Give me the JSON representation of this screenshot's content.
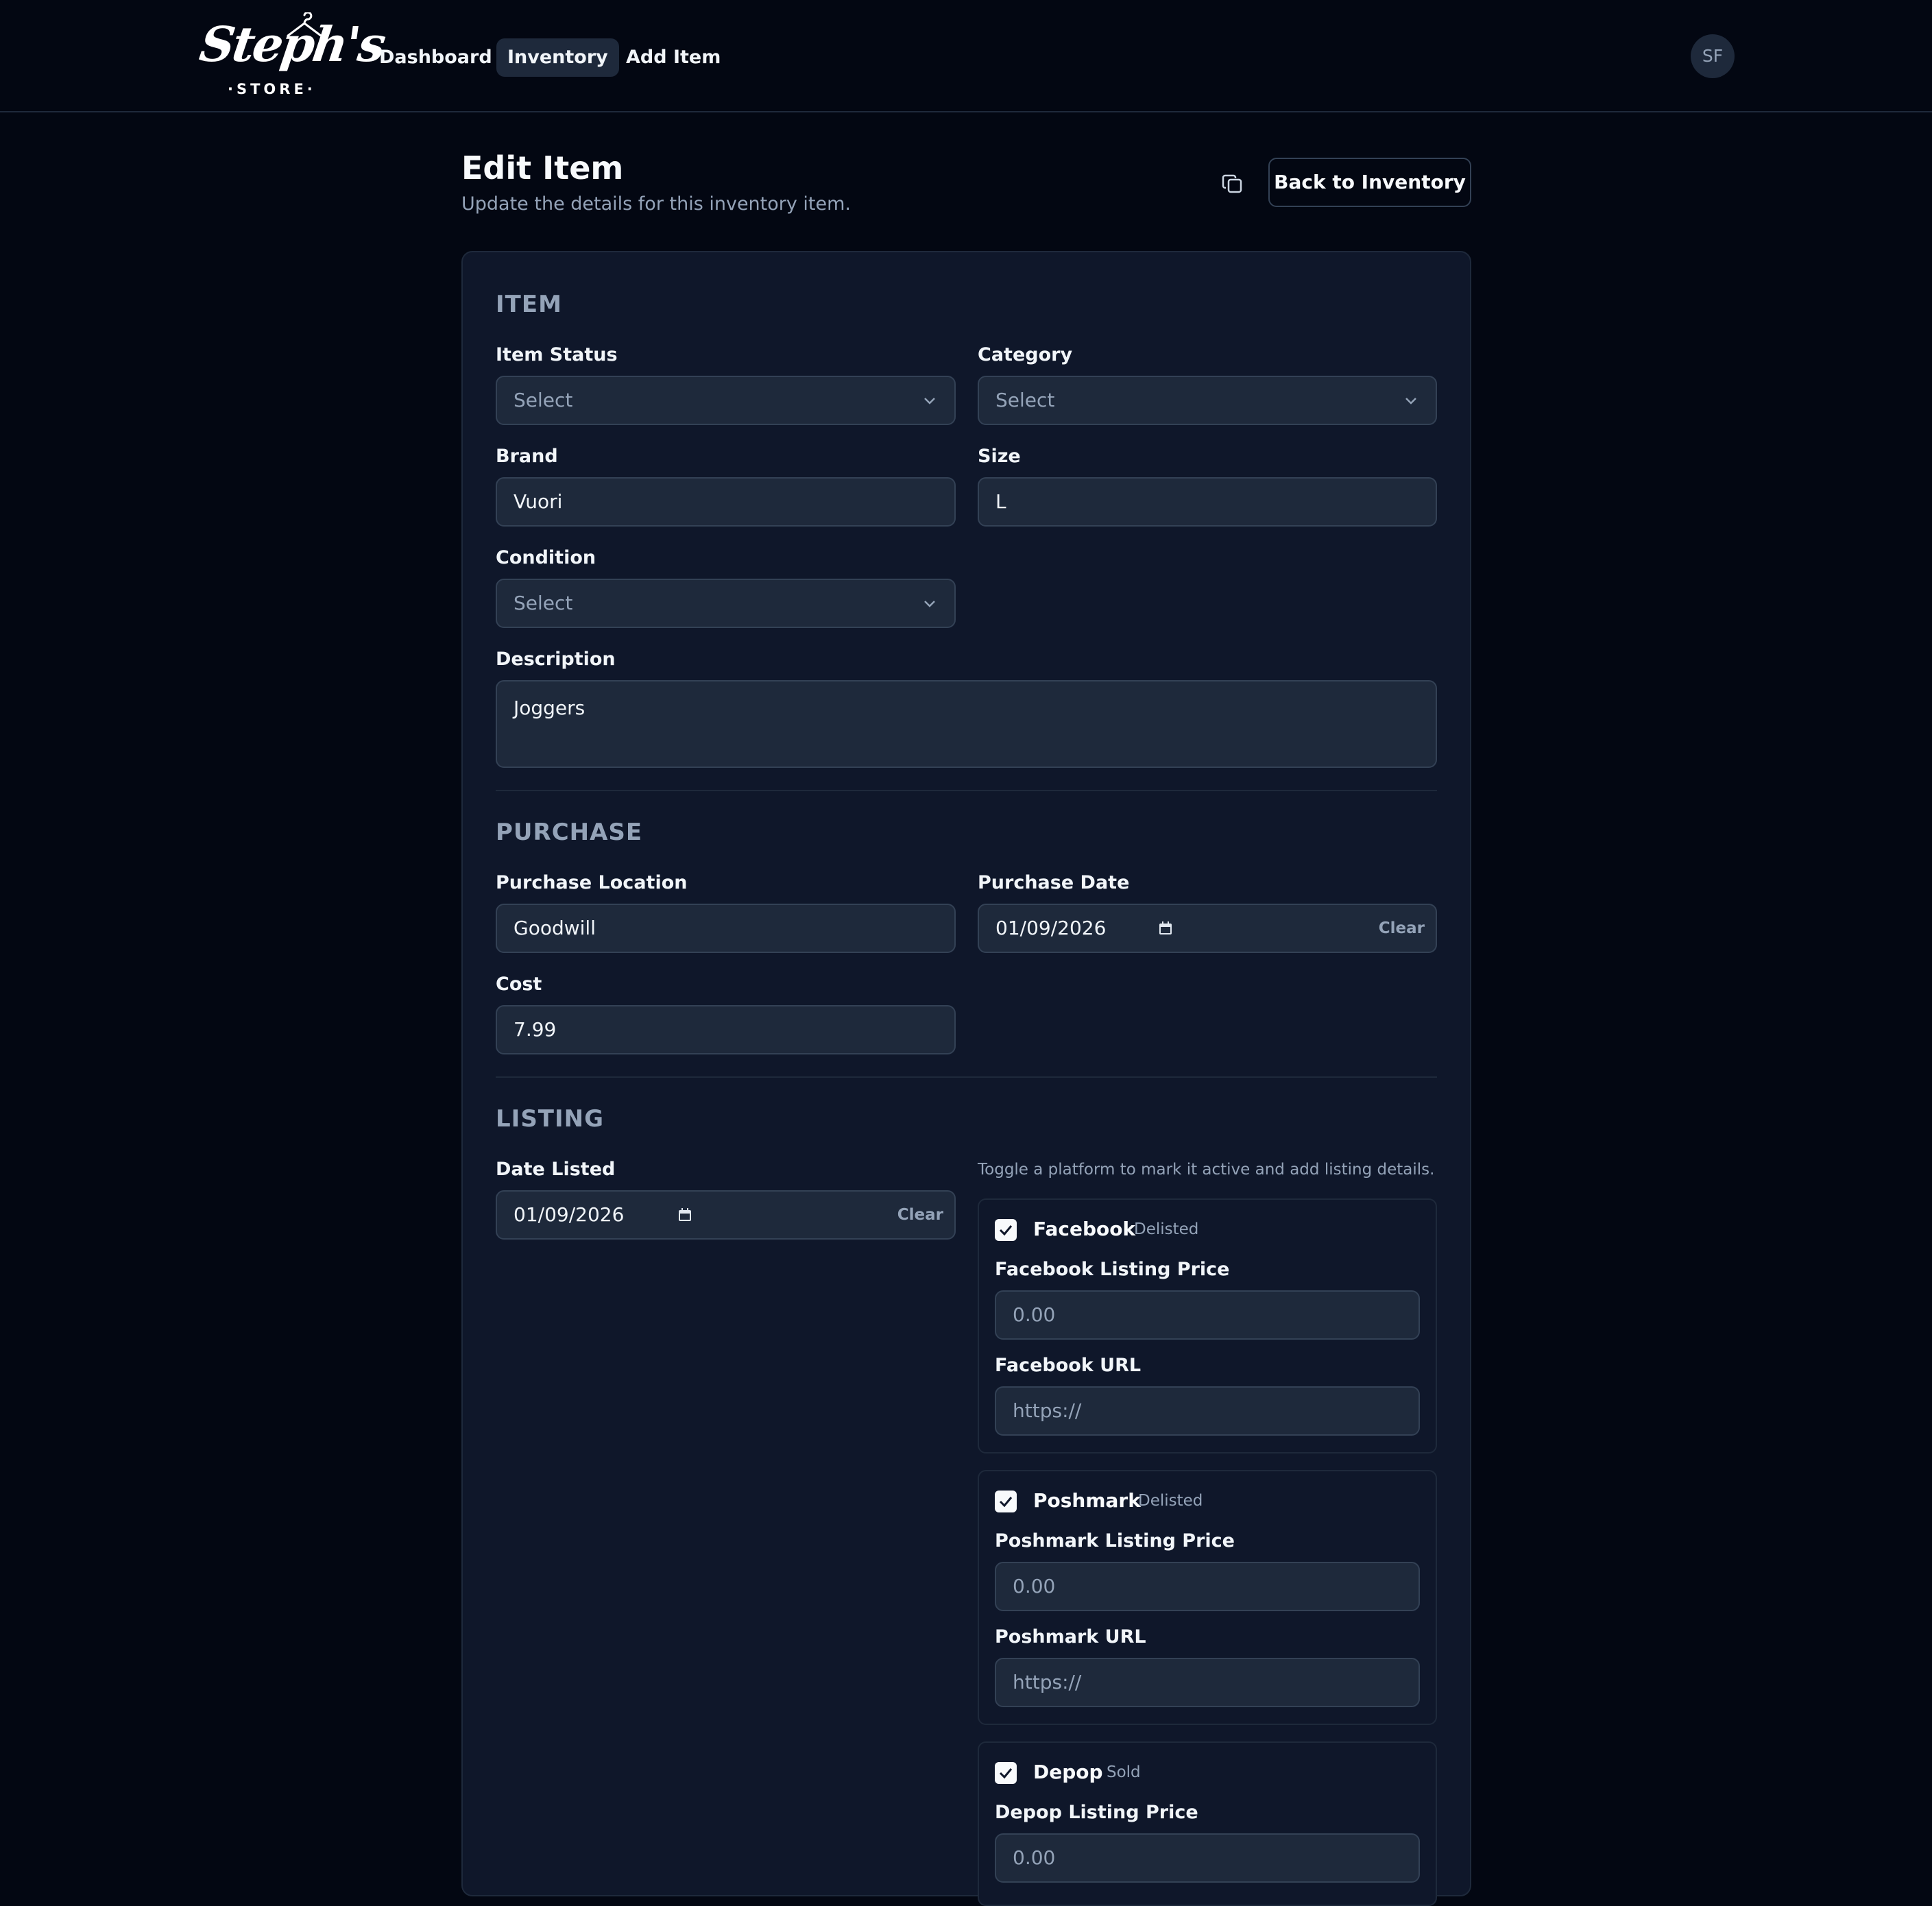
{
  "nav": {
    "logo_script": "Steph's",
    "logo_sub": "·STORE·",
    "links": [
      {
        "label": "Dashboard",
        "active": false
      },
      {
        "label": "Inventory",
        "active": true
      },
      {
        "label": "Add Item",
        "active": false
      }
    ],
    "avatar_initials": "SF"
  },
  "header": {
    "title": "Edit Item",
    "subtitle": "Update the details for this inventory item.",
    "copy_icon": "copy-icon",
    "back_label": "Back to Inventory"
  },
  "item": {
    "heading": "ITEM",
    "status": {
      "label": "Item Status",
      "placeholder": "Select"
    },
    "category": {
      "label": "Category",
      "placeholder": "Select"
    },
    "brand": {
      "label": "Brand",
      "value": "Vuori"
    },
    "size": {
      "label": "Size",
      "value": "L"
    },
    "condition": {
      "label": "Condition",
      "placeholder": "Select"
    },
    "description": {
      "label": "Description",
      "value": "Joggers"
    }
  },
  "purchase": {
    "heading": "PURCHASE",
    "location": {
      "label": "Purchase Location",
      "value": "Goodwill"
    },
    "date": {
      "label": "Purchase Date",
      "value": "01/09/2026",
      "clear": "Clear"
    },
    "cost": {
      "label": "Cost",
      "value": "7.99"
    }
  },
  "listing": {
    "heading": "LISTING",
    "date_listed": {
      "label": "Date Listed",
      "value": "01/09/2026",
      "clear": "Clear"
    },
    "hint": "Toggle a platform to mark it active and add listing details.",
    "platforms": [
      {
        "name": "Facebook",
        "status": "Delisted",
        "checked": true,
        "price_label": "Facebook Listing Price",
        "price_placeholder": "0.00",
        "url_label": "Facebook URL",
        "url_placeholder": "https://"
      },
      {
        "name": "Poshmark",
        "status": "Delisted",
        "checked": true,
        "price_label": "Poshmark Listing Price",
        "price_placeholder": "0.00",
        "url_label": "Poshmark URL",
        "url_placeholder": "https://"
      },
      {
        "name": "Depop",
        "status": "Sold",
        "checked": true,
        "price_label": "Depop Listing Price",
        "price_placeholder": "0.00"
      }
    ]
  },
  "colors": {
    "background": "#030712",
    "card": "#0f172a",
    "input": "#1e293b",
    "border": "#334155",
    "muted_text": "#94a3b8",
    "text": "#f1f5f9"
  }
}
